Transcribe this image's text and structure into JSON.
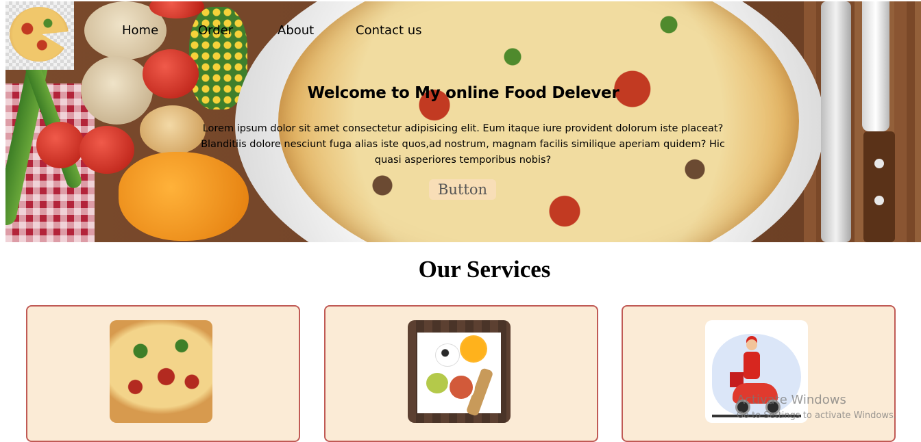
{
  "nav": {
    "home": "Home",
    "order": "Order",
    "about": "About",
    "contact": "Contact us"
  },
  "hero": {
    "title": "Welcome to My online Food Delever",
    "text": "Lorem ipsum dolor sit amet consectetur adipisicing elit. Eum itaque iure provident dolorum iste placeat? Blanditiis dolore nesciunt fuga alias iste quos,ad nostrum, magnam facilis similique aperiam quidem? Hic quasi asperiores temporibus nobis?",
    "button_label": "Button"
  },
  "services": {
    "title": "Our Services",
    "cards": [
      {
        "icon": "pizza-image"
      },
      {
        "icon": "food-platter-image"
      },
      {
        "icon": "delivery-scooter-image"
      }
    ]
  },
  "watermark": {
    "line1": "Activate Windows",
    "line2": "Go to Settings to activate Windows."
  },
  "colors": {
    "card_background": "#fbebd6",
    "card_border": "#c05a55",
    "button_background": "#f8deb7"
  }
}
